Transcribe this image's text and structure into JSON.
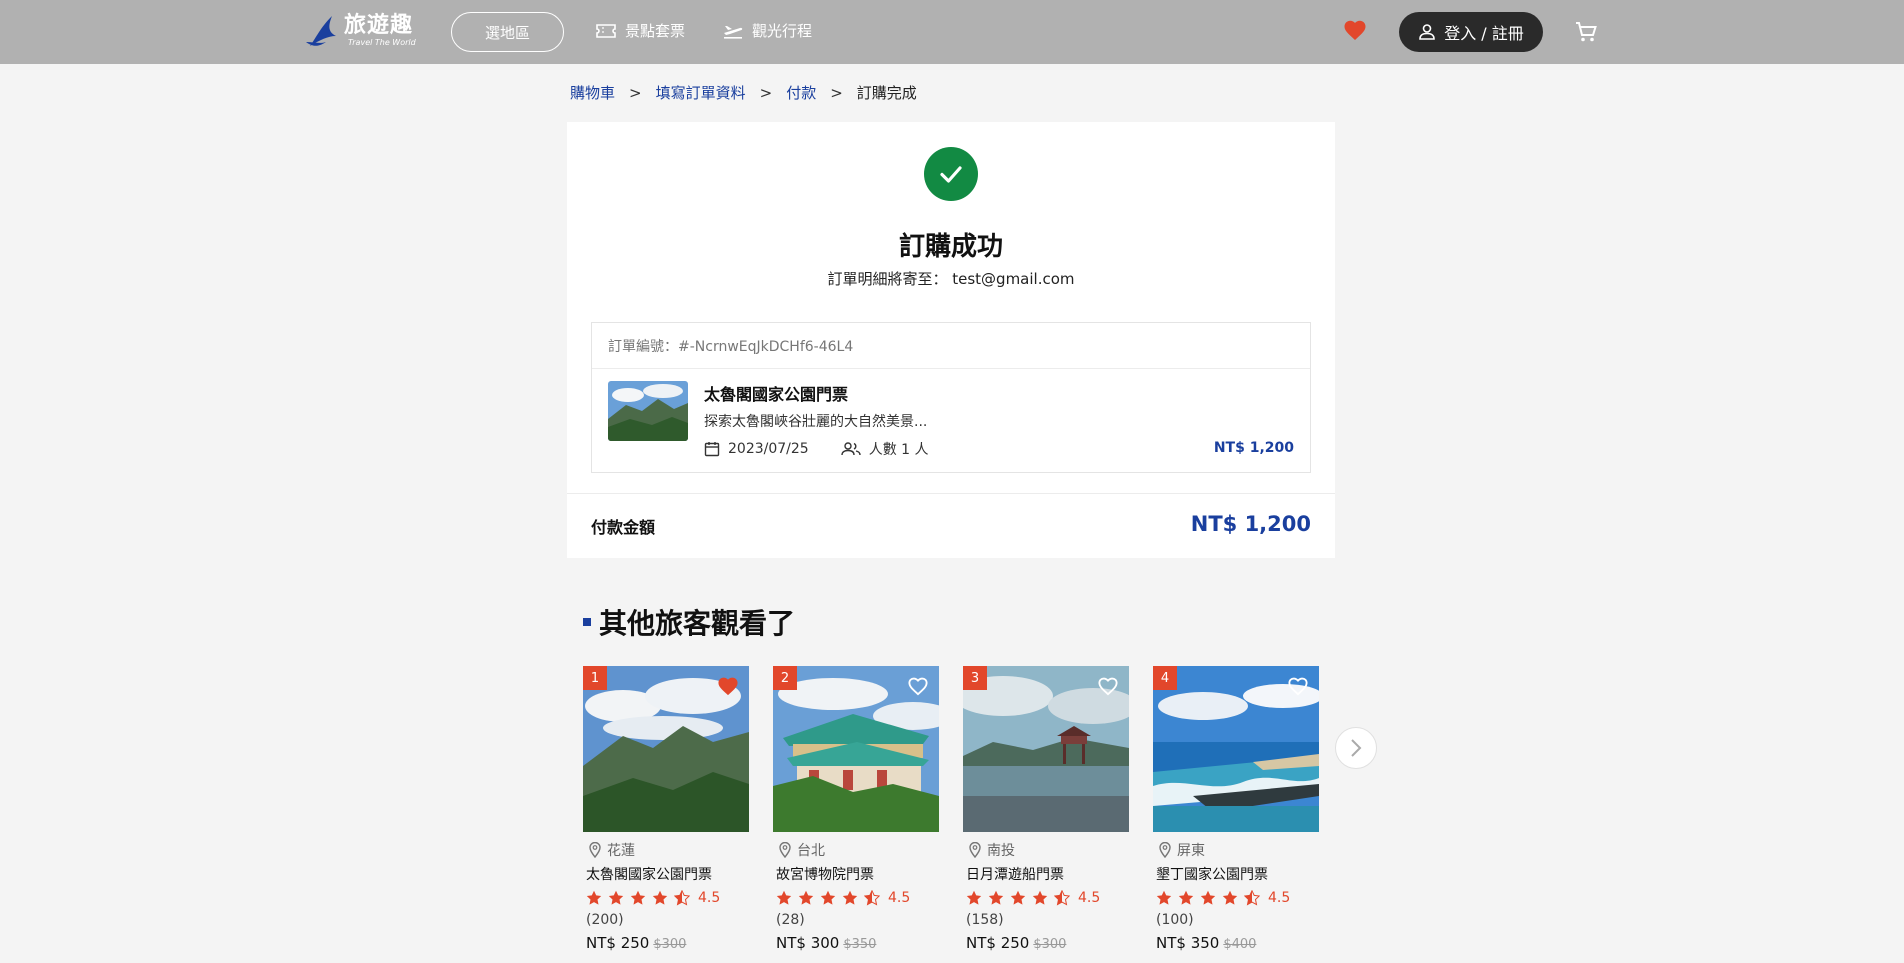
{
  "header": {
    "logo_title": "旅遊趣",
    "logo_subtitle": "Travel The World",
    "region_button": "選地區",
    "nav": [
      {
        "label": "景點套票",
        "icon": "ticket-icon"
      },
      {
        "label": "觀光行程",
        "icon": "plane-icon"
      }
    ],
    "favorites_icon": "heart-icon",
    "login_label": "登入 / 註冊",
    "cart_icon": "cart-icon"
  },
  "breadcrumb": {
    "items": [
      "購物車",
      "填寫訂單資料",
      "付款",
      "訂購完成"
    ],
    "separator": ">"
  },
  "success": {
    "title": "訂購成功",
    "subtitle": "訂單明細將寄至： test@gmail.com"
  },
  "order": {
    "number": "訂單編號：#-NcrnwEqJkDCHf6-46L4",
    "item": {
      "title": "太魯閣國家公園門票",
      "description": "探索太魯閣峽谷壯麗的大自然美景...",
      "date": "2023/07/25",
      "people": "人數 1 人",
      "price": "NT$ 1,200"
    }
  },
  "total": {
    "label": "付款金額",
    "value": "NT$ 1,200"
  },
  "recommendations": {
    "heading": "其他旅客觀看了",
    "items": [
      {
        "rank": "1",
        "location": "花蓮",
        "name": "太魯閣國家公園門票",
        "rating": "4.5",
        "reviews": "(200)",
        "price": "NT$ 250",
        "old_price": "$300",
        "favorited": true
      },
      {
        "rank": "2",
        "location": "台北",
        "name": "故宮博物院門票",
        "rating": "4.5",
        "reviews": "(28)",
        "price": "NT$ 300",
        "old_price": "$350",
        "favorited": false
      },
      {
        "rank": "3",
        "location": "南投",
        "name": "日月潭遊船門票",
        "rating": "4.5",
        "reviews": "(158)",
        "price": "NT$ 250",
        "old_price": "$300",
        "favorited": false
      },
      {
        "rank": "4",
        "location": "屏東",
        "name": "墾丁國家公園門票",
        "rating": "4.5",
        "reviews": "(100)",
        "price": "NT$ 350",
        "old_price": "$400",
        "favorited": false
      }
    ]
  },
  "colors": {
    "header_bg": "#b1b1b1",
    "brand_blue": "#1a3f9e",
    "success_green": "#128a43",
    "accent_red": "#e2472b"
  }
}
